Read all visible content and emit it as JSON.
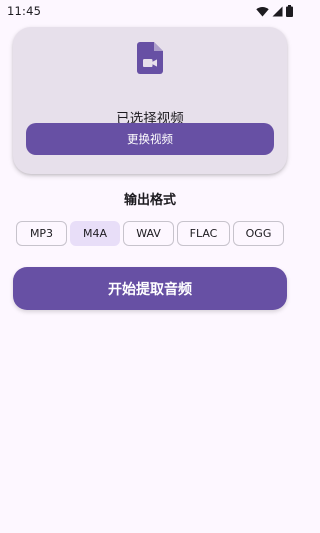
{
  "status_bar": {
    "time": "11:45",
    "icons": [
      "wifi-icon",
      "signal-icon",
      "battery-icon"
    ]
  },
  "video_card": {
    "icon": "video-file-icon",
    "status": "已选择视频",
    "change_label": "更换视频"
  },
  "format": {
    "title": "输出格式",
    "options": [
      "MP3",
      "M4A",
      "WAV",
      "FLAC",
      "OGG"
    ],
    "selected": "M4A"
  },
  "extract_label": "开始提取音频",
  "colors": {
    "primary": "#6750a4",
    "card_background": "#e7e0eb",
    "selected_chip": "#e8def8",
    "page_background": "#fdf7ff"
  }
}
